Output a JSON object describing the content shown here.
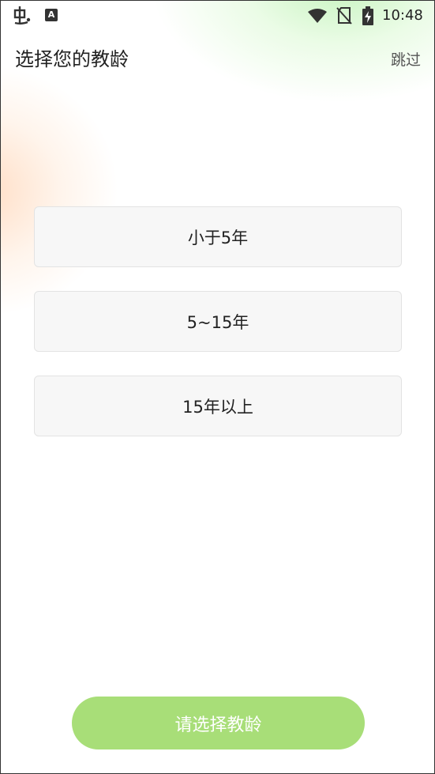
{
  "status_bar": {
    "left_icons": [
      "bug-app-icon",
      "font-a-icon"
    ],
    "right_icons": [
      "wifi-icon",
      "no-sim-icon",
      "battery-charging-icon"
    ],
    "time": "10:48",
    "a_badge": "A"
  },
  "header": {
    "title": "选择您的教龄",
    "skip_label": "跳过"
  },
  "options": [
    {
      "label": "小于5年"
    },
    {
      "label": "5~15年"
    },
    {
      "label": "15年以上"
    }
  ],
  "confirm_button": {
    "label": "请选择教龄"
  },
  "colors": {
    "button": "#a8de78",
    "option_bg": "#f7f7f7",
    "accent_glow_green": "#c8f5bc",
    "accent_glow_orange": "#ffd9bd"
  }
}
